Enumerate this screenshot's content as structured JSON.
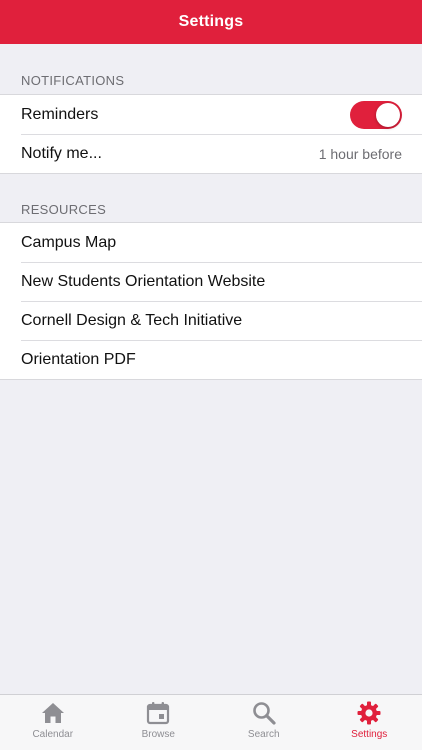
{
  "header": {
    "title": "Settings"
  },
  "colors": {
    "accent": "#e0203c",
    "inactive": "#8e8e93",
    "background": "#efeff4"
  },
  "notifications": {
    "header": "NOTIFICATIONS",
    "reminders_label": "Reminders",
    "reminders_enabled": true,
    "notify_label": "Notify me...",
    "notify_value": "1 hour before"
  },
  "resources": {
    "header": "RESOURCES",
    "items": [
      {
        "label": "Campus Map"
      },
      {
        "label": "New Students Orientation Website"
      },
      {
        "label": "Cornell Design & Tech Initiative"
      },
      {
        "label": "Orientation PDF"
      }
    ]
  },
  "tabs": [
    {
      "label": "Calendar",
      "icon": "home-icon",
      "active": false
    },
    {
      "label": "Browse",
      "icon": "calendar-icon",
      "active": false
    },
    {
      "label": "Search",
      "icon": "search-icon",
      "active": false
    },
    {
      "label": "Settings",
      "icon": "gear-icon",
      "active": true
    }
  ]
}
